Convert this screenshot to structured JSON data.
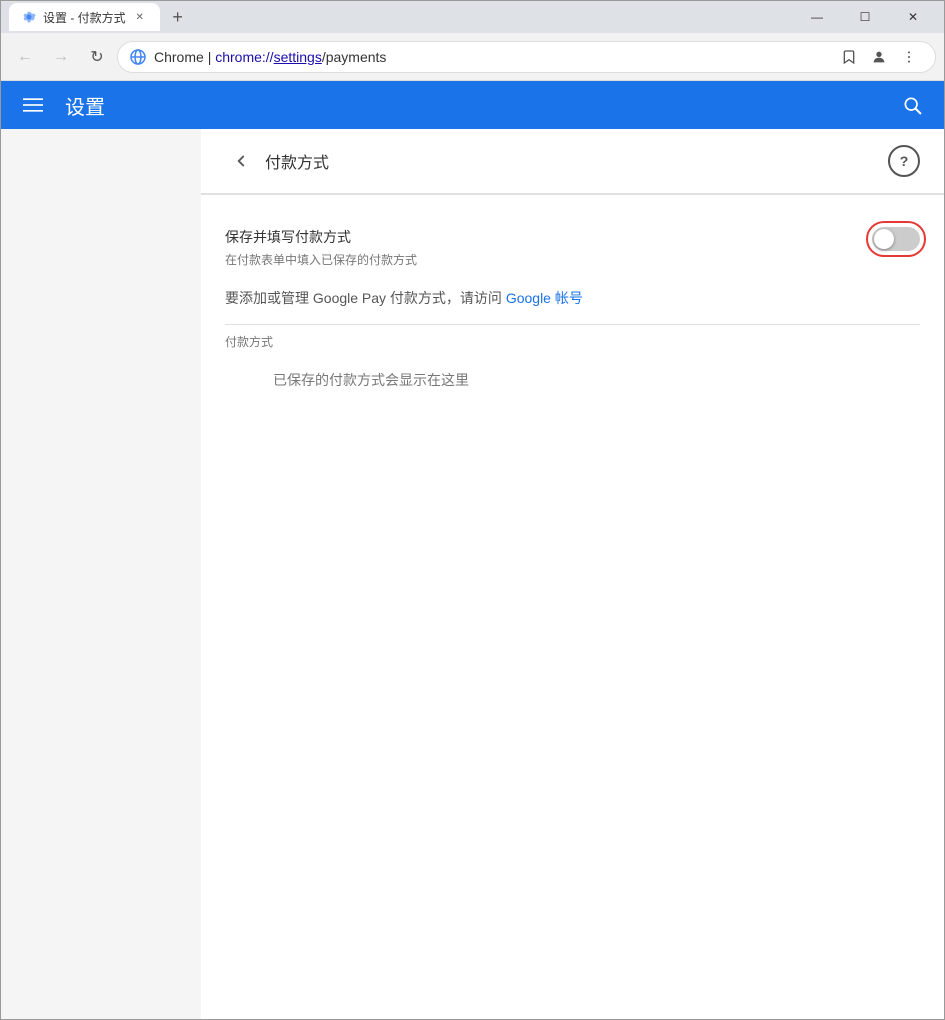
{
  "window": {
    "title": "设置 - 付款方式",
    "tab_label": "设置 - 付款方式",
    "new_tab_btn": "+",
    "controls": {
      "minimize": "—",
      "maximize": "☐",
      "close": "✕"
    }
  },
  "navbar": {
    "chrome_text": "Chrome",
    "separator": "|",
    "url_prefix": "chrome://",
    "url_settings": "settings",
    "url_suffix": "/payments"
  },
  "settings_bar": {
    "title": "设置",
    "hamburger_label": "☰"
  },
  "page": {
    "title": "付款方式",
    "save_toggle_label": "保存并填写付款方式",
    "save_toggle_desc": "在付款表单中填入已保存的付款方式",
    "google_pay_text_before": "要添加或管理 Google Pay 付款方式，请访问",
    "google_pay_link": "Google 帐号",
    "google_pay_text_after": "",
    "payment_methods_label": "付款方式",
    "saved_placeholder": "已保存的付款方式会显示在这里",
    "help_label": "?"
  },
  "toggle": {
    "state": false
  }
}
